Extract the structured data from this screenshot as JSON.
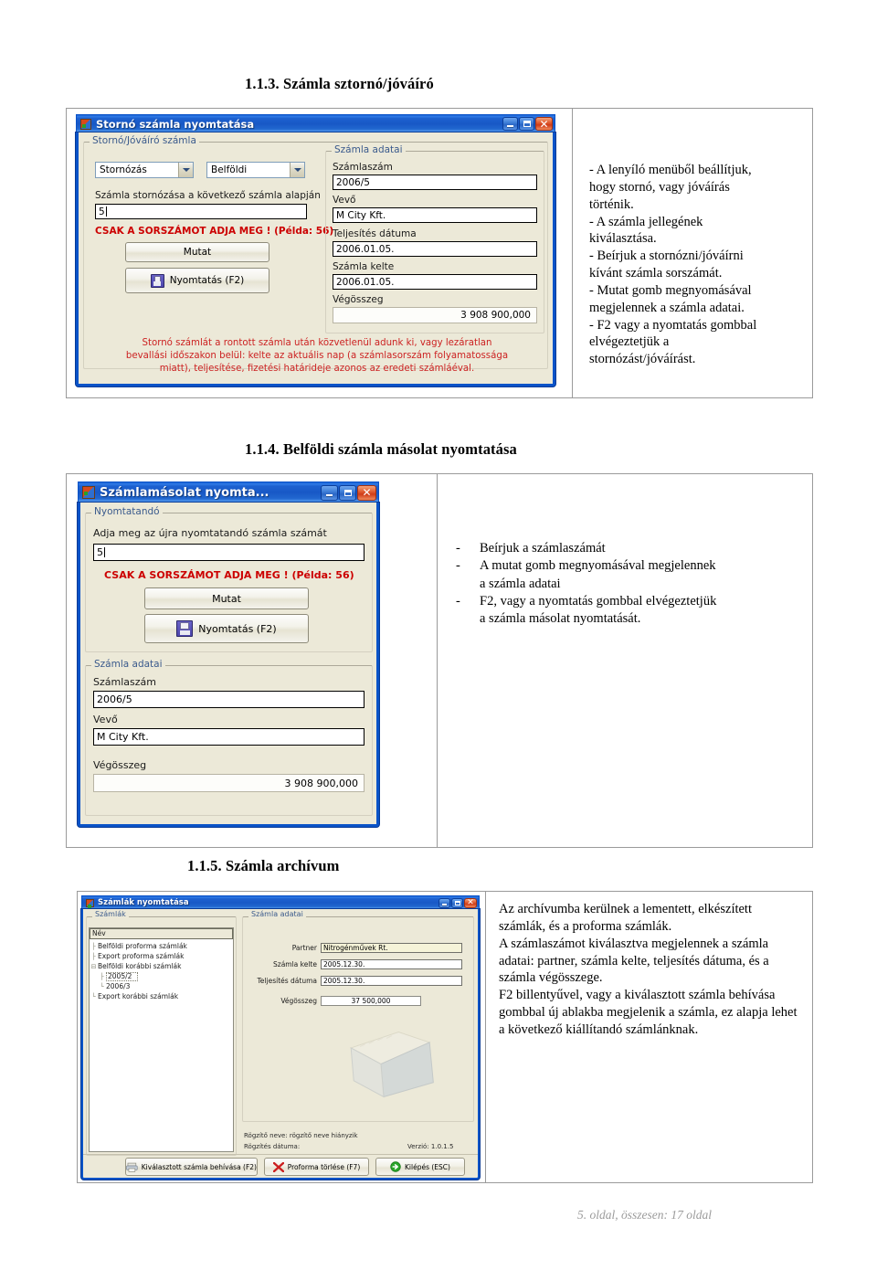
{
  "sections": [
    {
      "heading": "1.1.3. Számla sztornó/jóváíró",
      "window": {
        "title": "Stornó számla nyomtatása",
        "group_left": "Stornó/Jóváíró számla",
        "combo_type": "Stornózás",
        "combo_kind": "Belföldi",
        "label_base": "Számla stornózása a következő számla alapján",
        "input_value": "5",
        "warning": "CSAK A SORSZÁMOT ADJA MEG ! (Példa: 56)",
        "btn_show": "Mutat",
        "btn_print": "Nyomtatás (F2)",
        "group_right": "Számla adatai",
        "lbl_invoice_no": "Számlaszám",
        "val_invoice_no": "2006/5",
        "lbl_customer": "Vevő",
        "val_customer": "M City Kft.",
        "lbl_fulfil": "Teljesítés dátuma",
        "val_fulfil": "2006.01.05.",
        "lbl_issued": "Számla kelte",
        "val_issued": "2006.01.05.",
        "lbl_total": "Végösszeg",
        "val_total": "3 908 900,000",
        "red_note_l1": "Stornó számlát a rontott számla után közvetlenül adunk ki, vagy lezáratlan",
        "red_note_l2": "bevallási időszakon belül: kelte az aktuális nap (a számlasorszám folyamatossága",
        "red_note_l3": "miatt), teljesítése, fizetési határideje azonos az eredeti számláéval."
      },
      "note_lines": [
        "- A lenyíló menüből beállítjuk,",
        "hogy stornó, vagy jóváírás",
        "történik.",
        "- A számla jellegének",
        "kiválasztása.",
        "- Beírjuk a stornózni/jóváírni",
        "kívánt számla sorszámát.",
        "- Mutat gomb megnyomásával",
        "megjelennek a számla adatai.",
        "- F2 vagy a nyomtatás gombbal",
        "elvégeztetjük a",
        "stornózást/jóváírást."
      ]
    },
    {
      "heading": "1.1.4. Belföldi számla másolat nyomtatása",
      "window": {
        "title": "Számlamásolat nyomta...",
        "group_top": "Nyomtatandó",
        "label_prompt": "Adja meg az újra nyomtatandó számla számát",
        "input_value": "5",
        "warning": "CSAK A SORSZÁMOT ADJA MEG ! (Példa: 56)",
        "btn_show": "Mutat",
        "btn_print": "Nyomtatás (F2)",
        "group_bottom": "Számla adatai",
        "lbl_invoice_no": "Számlaszám",
        "val_invoice_no": "2006/5",
        "lbl_customer": "Vevő",
        "val_customer": "M City Kft.",
        "lbl_total": "Végösszeg",
        "val_total": "3 908 900,000"
      },
      "bullets": [
        {
          "mark": "-",
          "lines": [
            "Beírjuk a számlaszámát"
          ]
        },
        {
          "mark": "-",
          "lines": [
            "A mutat gomb megnyomásával megjelennek",
            "a számla adatai"
          ]
        },
        {
          "mark": "-",
          "lines": [
            "F2, vagy a nyomtatás gombbal elvégeztetjük",
            "a számla másolat nyomtatását."
          ]
        }
      ]
    },
    {
      "heading": "1.1.5. Számla archívum",
      "window": {
        "title": "Számlák nyomtatása",
        "group_tree": "Számlák",
        "tree_header": "Név",
        "tree_items": [
          {
            "label": "Belföldi proforma számlák",
            "indent": 0,
            "selected": false
          },
          {
            "label": "Export proforma számlák",
            "indent": 0,
            "selected": false
          },
          {
            "label": "Belföldi korábbi számlák",
            "indent": 0,
            "selected": false,
            "expander": true
          },
          {
            "label": "2005/2",
            "indent": 1,
            "selected": true
          },
          {
            "label": "2006/3",
            "indent": 1,
            "selected": false
          },
          {
            "label": "Export korábbi számlák",
            "indent": 0,
            "selected": false
          }
        ],
        "group_data": "Számla adatai",
        "fields": [
          {
            "label": "Partner",
            "value": "Nitrogénművek Rt.",
            "highlight": true
          },
          {
            "label": "Számla kelte",
            "value": "2005.12.30.",
            "highlight": false
          },
          {
            "label": "Teljesítés dátuma",
            "value": "2005.12.30.",
            "highlight": false
          }
        ],
        "total_label": "Végösszeg",
        "total_value": "37 500,000",
        "status_recorder": "Rögzítő neve: rögzítő neve hiányzik",
        "status_date": "Rögzítés dátuma:",
        "version": "Verzió: 1.0.1.5",
        "btn_open": "Kiválasztott számla behívása (F2)",
        "btn_delete": "Proforma törlése (F7)",
        "btn_exit": "Kilépés (ESC)"
      },
      "note_paragraphs": [
        "Az archívumba kerülnek a lementett, elkészített számlák, és a proforma számlák.",
        "A számlaszámot kiválasztva megjelennek a számla adatai: partner, számla kelte, teljesítés dátuma, és a számla végösszege.",
        "F2 billentyűvel, vagy a kiválasztott számla behívása gombbal új ablakba megjelenik a számla, ez alapja lehet a következő kiállítandó számlánknak."
      ]
    }
  ],
  "footer": "5. oldal, összesen: 17 oldal"
}
